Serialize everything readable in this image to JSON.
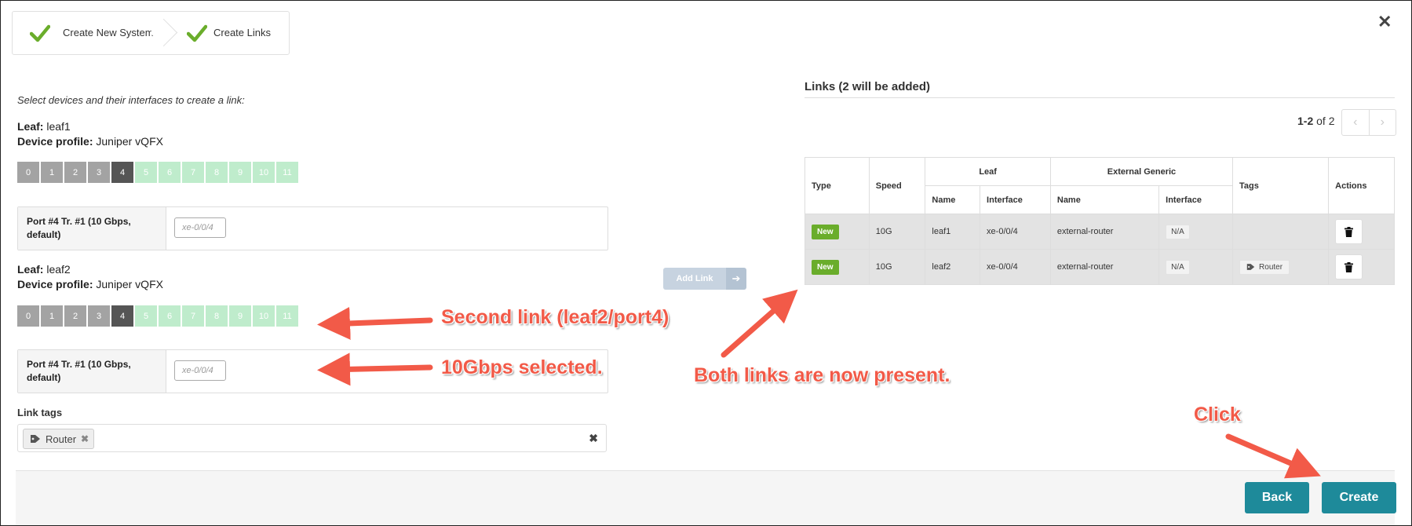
{
  "wizard": {
    "steps": [
      {
        "label": "Create New System"
      },
      {
        "label": "Create Links"
      }
    ]
  },
  "left": {
    "instruction": "Select devices and their interfaces to create a link:",
    "leaf_key": "Leaf:",
    "profile_key": "Device profile:",
    "devices": [
      {
        "leaf": "leaf1",
        "profile": "Juniper vQFX",
        "ports": [
          "0",
          "1",
          "2",
          "3",
          "4",
          "5",
          "6",
          "7",
          "8",
          "9",
          "10",
          "11"
        ],
        "port_label": "Port #4 Tr. #1 (10 Gbps, default)",
        "port_placeholder": "xe-0/0/4"
      },
      {
        "leaf": "leaf2",
        "profile": "Juniper vQFX",
        "ports": [
          "0",
          "1",
          "2",
          "3",
          "4",
          "5",
          "6",
          "7",
          "8",
          "9",
          "10",
          "11"
        ],
        "port_label": "Port #4 Tr. #1 (10 Gbps, default)",
        "port_placeholder": "xe-0/0/4"
      }
    ],
    "tags_label": "Link tags",
    "tag": "Router",
    "add_link": "Add Link"
  },
  "links": {
    "title": "Links (2 will be added)",
    "pager_range": "1-2",
    "pager_of": "of 2",
    "headers": {
      "type": "Type",
      "speed": "Speed",
      "leaf": "Leaf",
      "external": "External Generic",
      "name": "Name",
      "interface": "Interface",
      "tags": "Tags",
      "actions": "Actions"
    },
    "rows": [
      {
        "type": "New",
        "speed": "10G",
        "leaf_name": "leaf1",
        "leaf_iface": "xe-0/0/4",
        "ext_name": "external-router",
        "ext_iface": "N/A",
        "tag": ""
      },
      {
        "type": "New",
        "speed": "10G",
        "leaf_name": "leaf2",
        "leaf_iface": "xe-0/0/4",
        "ext_name": "external-router",
        "ext_iface": "N/A",
        "tag": "Router"
      }
    ]
  },
  "footer": {
    "back": "Back",
    "create": "Create"
  },
  "annotations": {
    "second_link": "Second link (leaf2/port4)",
    "speed": "10Gbps selected.",
    "both": "Both links are now present.",
    "click": "Click"
  },
  "colors": {
    "accent": "#1e8a9a",
    "new_badge": "#6aad2b",
    "annotation": "#f25a48",
    "port_free": "#bfeccc",
    "port_used": "#a3a3a3",
    "port_selected": "#555555"
  }
}
